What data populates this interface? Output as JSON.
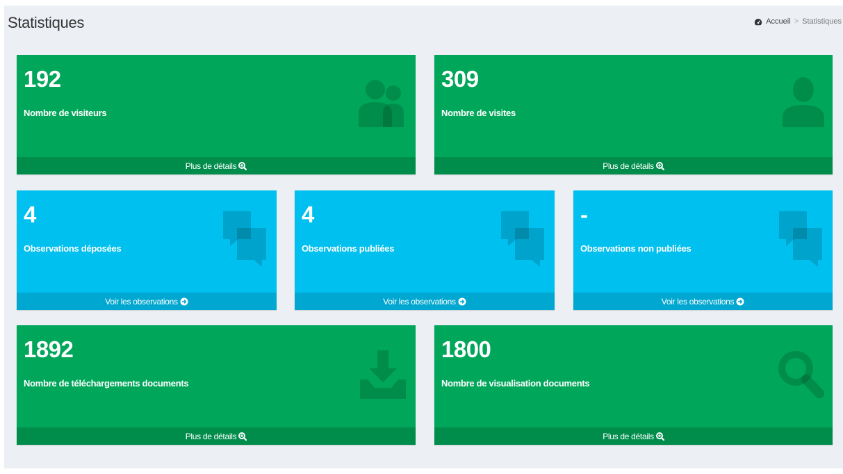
{
  "header": {
    "title": "Statistiques",
    "breadcrumb": {
      "home_icon": "dashboard-icon",
      "home": "Accueil",
      "separator": ">",
      "current": "Statistiques"
    }
  },
  "colors": {
    "green": "#00a65a",
    "green_dark": "#008d4c",
    "aqua": "#00c0ef",
    "aqua_dark": "#00a7d0",
    "background": "#ecf0f5"
  },
  "boxes": [
    {
      "value": "192",
      "label": "Nombre de visiteurs",
      "icon": "users-icon",
      "footer": "Plus de détails",
      "footer_icon": "zoom-in-icon"
    },
    {
      "value": "309",
      "label": "Nombre de visites",
      "icon": "user-icon",
      "footer": "Plus de détails",
      "footer_icon": "zoom-in-icon"
    },
    {
      "value": "4",
      "label": "Observations déposées",
      "icon": "comments-icon",
      "footer": "Voir les observations",
      "footer_icon": "arrow-circle-right-icon"
    },
    {
      "value": "4",
      "label": "Observations publiées",
      "icon": "comments-icon",
      "footer": "Voir les observations",
      "footer_icon": "arrow-circle-right-icon"
    },
    {
      "value": "-",
      "label": "Observations non publiées",
      "icon": "comments-icon",
      "footer": "Voir les observations",
      "footer_icon": "arrow-circle-right-icon"
    },
    {
      "value": "1892",
      "label": "Nombre de téléchargements documents",
      "icon": "download-icon",
      "footer": "Plus de détails",
      "footer_icon": "zoom-in-icon"
    },
    {
      "value": "1800",
      "label": "Nombre de visualisation documents",
      "icon": "search-icon",
      "footer": "Plus de détails",
      "footer_icon": "zoom-in-icon"
    }
  ]
}
